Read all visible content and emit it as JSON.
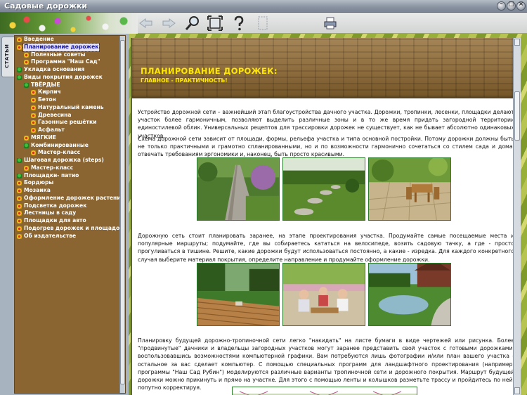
{
  "window": {
    "title": "Садовые дорожки"
  },
  "toolbar": {
    "icons": [
      "back-arrow-icon",
      "forward-arrow-icon",
      "search-magnifier-icon",
      "fullscreen-icon",
      "help-question-icon",
      "bookmark-icon",
      "print-icon"
    ]
  },
  "sidebar": {
    "tab_label": "СТАТЬИ",
    "items": [
      {
        "label": "Введение",
        "level": 0,
        "icon": "yellow"
      },
      {
        "label": "Планирование дорожек",
        "level": 0,
        "icon": "yellow",
        "selected": true
      },
      {
        "label": "Полезные советы",
        "level": 1,
        "icon": "yellow"
      },
      {
        "label": "Программа \"Наш Сад\"",
        "level": 1,
        "icon": "yellow"
      },
      {
        "label": "Укладка основания",
        "level": 0,
        "icon": "green"
      },
      {
        "label": "Виды покрытия дорожек",
        "level": 0,
        "icon": "green"
      },
      {
        "label": "ТВЁРДЫЕ",
        "level": 1,
        "icon": "green"
      },
      {
        "label": "Кирпич",
        "level": 2,
        "icon": "yellow"
      },
      {
        "label": "Бетон",
        "level": 2,
        "icon": "yellow"
      },
      {
        "label": "Натуральный камень",
        "level": 2,
        "icon": "yellow"
      },
      {
        "label": "Древесина",
        "level": 2,
        "icon": "yellow"
      },
      {
        "label": "Газонные решётки",
        "level": 2,
        "icon": "yellow"
      },
      {
        "label": "Асфальт",
        "level": 2,
        "icon": "yellow"
      },
      {
        "label": "МЯГКИЕ",
        "level": 1,
        "icon": "yellow"
      },
      {
        "label": "Комбинированные",
        "level": 1,
        "icon": "green"
      },
      {
        "label": "Мастер-класс",
        "level": 2,
        "icon": "yellow"
      },
      {
        "label": "Шаговая дорожка (steps)",
        "level": 0,
        "icon": "green"
      },
      {
        "label": "Мастер-класс",
        "level": 1,
        "icon": "yellow"
      },
      {
        "label": "Площадки- патио",
        "level": 0,
        "icon": "green"
      },
      {
        "label": "Бордюры",
        "level": 0,
        "icon": "yellow"
      },
      {
        "label": "Мозаика",
        "level": 0,
        "icon": "yellow"
      },
      {
        "label": "Оформление дорожек растения",
        "level": 0,
        "icon": "yellow"
      },
      {
        "label": "Подсветка дорожек",
        "level": 0,
        "icon": "yellow"
      },
      {
        "label": "Лестницы в саду",
        "level": 0,
        "icon": "yellow"
      },
      {
        "label": "Площадки для авто",
        "level": 0,
        "icon": "yellow"
      },
      {
        "label": "Подогрев дорожек и площадок",
        "level": 0,
        "icon": "yellow"
      },
      {
        "label": "Об издательстве",
        "level": 0,
        "icon": "yellow"
      }
    ]
  },
  "article": {
    "title": "ПЛАНИРОВАНИЕ ДОРОЖЕК:",
    "subtitle": "ГЛАВНОЕ - ПРАКТИЧНОСТЬ!",
    "paragraphs": [
      "Устройство дорожной сети – важнейший этап благоустройства дачного участка. Дорожки, тропинки, лесенки, площадки делают участок более гармоничным, позволяют выделить различные зоны и в то же время придать загородной территории единостилевой облик. Универсальных рецептов для трассировки дорожек не существует, как не бывает абсолютно одинаковых участков.",
      "Схема дорожной сети зависит от площади, формы, рельефа участка и типа основной постройки. Потому дорожки должны быть не только практичными и грамотно спланированными, но и по возможности гармонично сочетаться со стилем сада и дома, отвечать требованиям эргономики и, наконец, быть просто красивыми.",
      "Дорожную сеть стоит планировать заранее, на этапе проектирования участка. Продумайте самые посещаемые места и популярные маршруты; подумайте, где вы собираетесь кататься на велосипеде, возить садовую тачку, а где - просто прогуливаться в тишине. Решите, какие дорожки будут использоваться постоянно, а какие - изредка. Для каждого конкретного случая выберите материал покрытия, определите направление и продумайте оформление дорожки.",
      "Планировку будущей дорожно-тропиночной сети легко \"накидать\" на листе бумаги в виде чертежей или рисунка. Более \"продвинутые\" дачники и владельцы загородных участков могут заранее представить свой участок с готовыми дорожками, воспользовавшись возможностями компьютерной графики. Вам потребуются лишь фотографии и/или план вашего участка - остальное за вас сделает компьютер. С помощью специальных программ для ландшафтного проектирования (например, программы \"Наш Сад Рубин\") моделируются различные варианты тропиночной сети и дорожного покрытия. Маршрут будущей дорожки можно прикинуть и прямо на участке. Для этого с помощью ленты и колышков разметьте трассу и пройдитесь по ней, попутно корректируя."
    ]
  }
}
